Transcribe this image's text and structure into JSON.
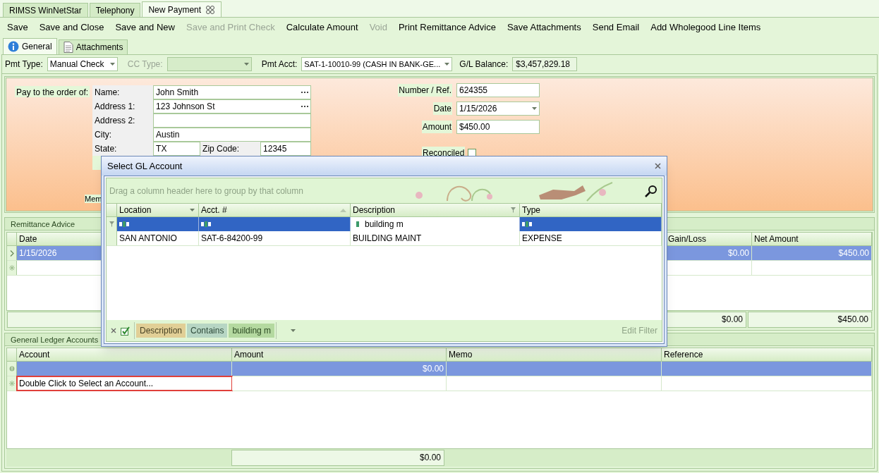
{
  "document_tabs": [
    {
      "label": "RIMSS WinNetStar",
      "selected": false,
      "closable": false
    },
    {
      "label": "Telephony",
      "selected": false,
      "closable": false
    },
    {
      "label": "New Payment",
      "selected": true,
      "closable": true
    }
  ],
  "toolbar": [
    {
      "label": "Save",
      "disabled": false
    },
    {
      "label": "Save and Close",
      "disabled": false
    },
    {
      "label": "Save and New",
      "disabled": false
    },
    {
      "label": "Save and Print Check",
      "disabled": true
    },
    {
      "label": "Calculate Amount",
      "disabled": false
    },
    {
      "label": "Void",
      "disabled": true
    },
    {
      "label": "Print Remittance Advice",
      "disabled": false
    },
    {
      "label": "Save Attachments",
      "disabled": false
    },
    {
      "label": "Send Email",
      "disabled": false
    },
    {
      "label": "Add Wholegood Line Items",
      "disabled": false
    }
  ],
  "form_tabs": [
    {
      "label": "General",
      "selected": true,
      "kind": "info"
    },
    {
      "label": "Attachments",
      "selected": false,
      "kind": "document"
    }
  ],
  "payment_bar": {
    "pmt_type_label": "Pmt Type:",
    "pmt_type": "Manual Check",
    "cc_type_label": "CC Type:",
    "cc_type_disabled": true,
    "pmt_acct_label": "Pmt Acct:",
    "pmt_acct": "SAT-1-10010-99 (CASH IN BANK-GE...",
    "gl_balance_label": "G/L Balance:",
    "gl_balance": "$3,457,829.18"
  },
  "check": {
    "pay_to_label": "Pay to the order of:",
    "address_fields": [
      {
        "label": "Name:",
        "value": "John Smith",
        "lookup": true
      },
      {
        "label": "Address 1:",
        "value": "123 Johnson St",
        "lookup": true
      },
      {
        "label": "Address 2:",
        "lookup": false
      },
      {
        "label": "City:",
        "value": "Austin",
        "lookup": false
      }
    ],
    "state_label": "State:",
    "state": "TX",
    "zip_label": "Zip Code:",
    "zip": "12345",
    "memo_label": "Mem",
    "right_fields": [
      {
        "label": "Number / Ref.",
        "value": "624355",
        "kind": "text"
      },
      {
        "label": "Date",
        "value": "1/15/2026",
        "kind": "dropdown"
      },
      {
        "label": "Amount",
        "value": "$450.00",
        "kind": "text"
      }
    ],
    "reconciled_label": "Reconciled",
    "reconciled": false
  },
  "remittance": {
    "title": "Remittance Advice",
    "columns": [
      "Date",
      "Gain/Loss",
      "Net Amount"
    ],
    "rows": [
      {
        "kind": "current",
        "selected": true,
        "cells": [
          "1/15/2026",
          "$0.00",
          "$450.00"
        ]
      },
      {
        "kind": "new",
        "selected": false
      }
    ],
    "totals": [
      "$0.00",
      "$450.00"
    ]
  },
  "gl": {
    "title": "General Ledger Accounts",
    "columns": [
      "Account",
      "Amount",
      "Memo",
      "Reference"
    ],
    "rows": [
      {
        "kind": "error",
        "selected": true,
        "highlighted": false,
        "cells": [
          null,
          "$0.00",
          null,
          null
        ]
      },
      {
        "kind": "new",
        "selected": false,
        "highlighted": true,
        "cells": [
          "Double Click to Select an Account...",
          null,
          null,
          null
        ]
      }
    ],
    "totals": [
      "$0.00"
    ]
  },
  "dialog": {
    "title": "Select GL Account",
    "group_hint": "Drag a column header here to group by that column",
    "columns": [
      {
        "label": "Location",
        "kind": "dropdown"
      },
      {
        "label": "Acct. #",
        "kind": "sort-ascending"
      },
      {
        "label": "Description",
        "kind": "filter"
      },
      {
        "label": "Type",
        "kind": "plain"
      }
    ],
    "filter_cells": [
      null,
      null,
      "building m",
      null
    ],
    "rows": [
      {
        "cells": [
          "SAN ANTONIO",
          "SAT-6-84200-99",
          "BUILDING MAINT",
          "EXPENSE"
        ],
        "selected": false
      }
    ],
    "filter": {
      "enabled": true,
      "field": "Description",
      "operator": "Contains",
      "value": "building m"
    },
    "edit_filter": "Edit Filter"
  }
}
